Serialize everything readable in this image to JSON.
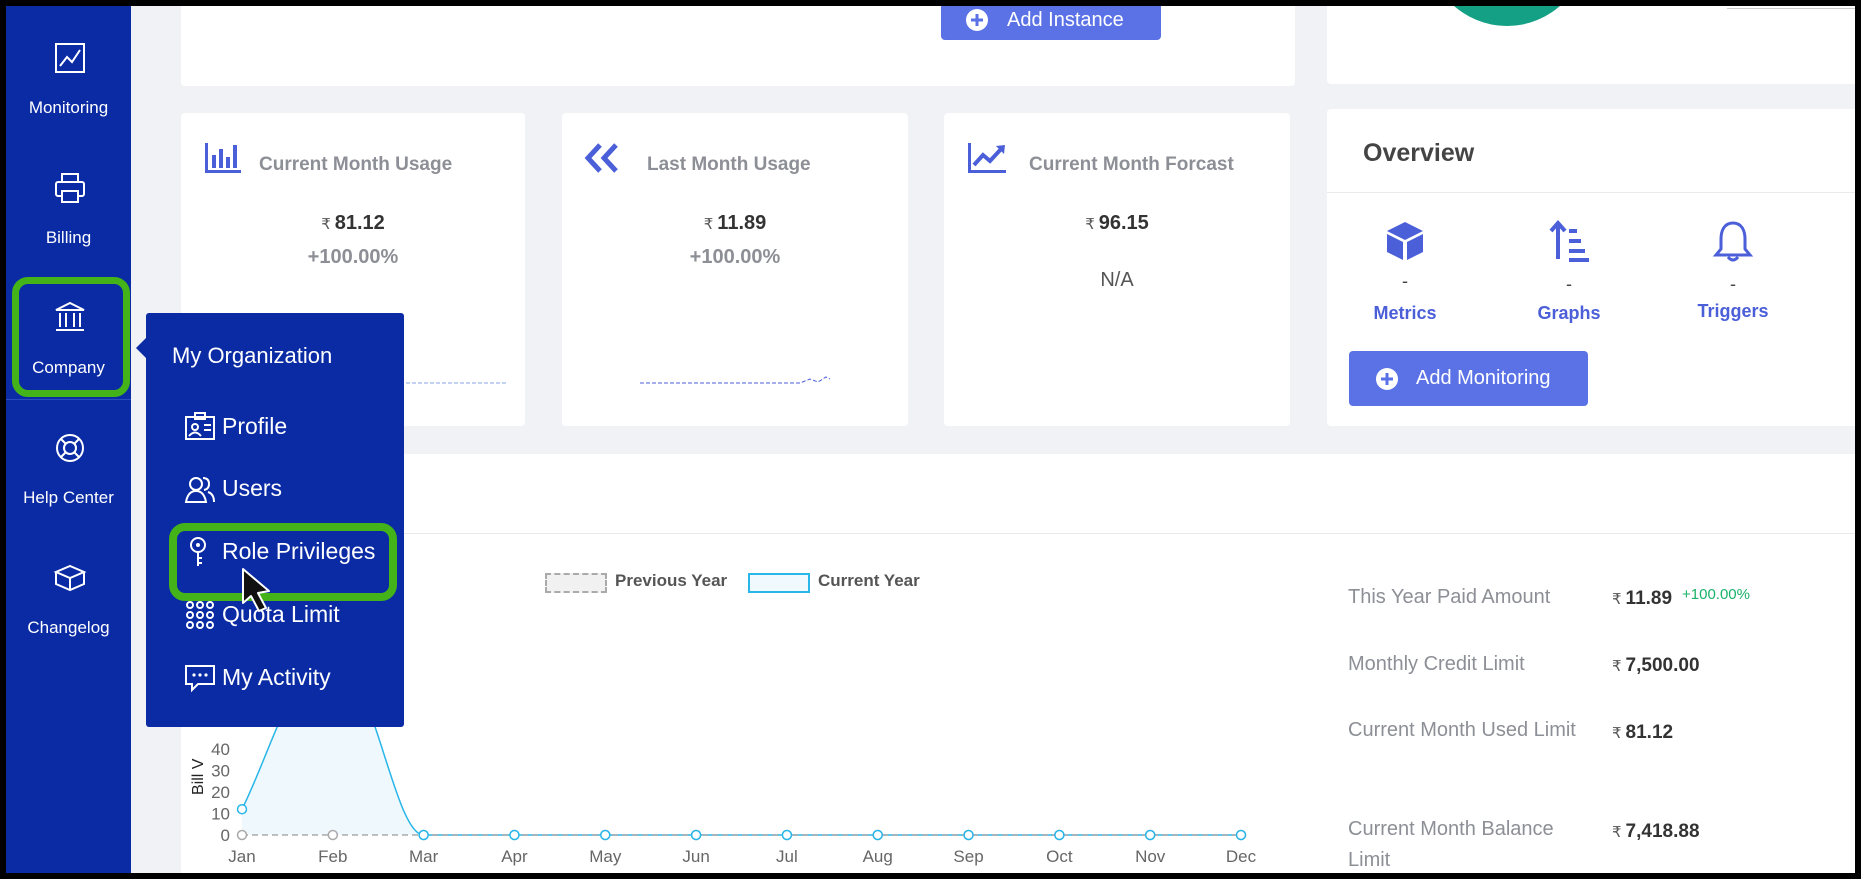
{
  "sidebar": {
    "items": [
      {
        "label": "Monitoring",
        "icon": "chart-line-icon"
      },
      {
        "label": "Billing",
        "icon": "printer-icon"
      },
      {
        "label": "Company",
        "icon": "bank-icon"
      },
      {
        "label": "Help Center",
        "icon": "lifebuoy-icon"
      },
      {
        "label": "Changelog",
        "icon": "box-icon"
      }
    ],
    "active": "Company"
  },
  "top": {
    "add_instance_label": "Add Instance"
  },
  "usage_cards": [
    {
      "title": "Current Month Usage",
      "currency": "₹",
      "value": "81.12",
      "change": "+100.00%"
    },
    {
      "title": "Last Month Usage",
      "currency": "₹",
      "value": "11.89",
      "change": "+100.00%"
    },
    {
      "title": "Current Month Forcast",
      "currency": "₹",
      "value": "96.15",
      "note": "N/A"
    }
  ],
  "overview": {
    "title": "Overview",
    "stats": [
      {
        "label": "Metrics",
        "value": "-",
        "icon": "cube-icon"
      },
      {
        "label": "Graphs",
        "value": "-",
        "icon": "sort-list-icon"
      },
      {
        "label": "Triggers",
        "value": "-",
        "icon": "bell-icon"
      }
    ],
    "add_monitoring_label": "Add Monitoring"
  },
  "org_menu": {
    "title": "My Organization",
    "items": [
      {
        "label": "Profile",
        "icon": "id-card-icon"
      },
      {
        "label": "Users",
        "icon": "users-icon"
      },
      {
        "label": "Role Privileges",
        "icon": "key-icon"
      },
      {
        "label": "Quota Limit",
        "icon": "grid-dots-icon"
      },
      {
        "label": "My Activity",
        "icon": "chat-icon"
      }
    ],
    "highlighted": "Role Privileges"
  },
  "chart_data": {
    "type": "line",
    "categories": [
      "Jan",
      "Feb",
      "Mar",
      "Apr",
      "May",
      "Jun",
      "Jul",
      "Aug",
      "Sep",
      "Oct",
      "Nov",
      "Dec"
    ],
    "series": [
      {
        "name": "Previous Year",
        "values": [
          0,
          0,
          0,
          0,
          0,
          0,
          0,
          0,
          0,
          0,
          0,
          0
        ],
        "style": "dashed",
        "color": "#aaaaaa"
      },
      {
        "name": "Current Year",
        "values": [
          12,
          81,
          0,
          0,
          0,
          0,
          0,
          0,
          0,
          0,
          0,
          0
        ],
        "style": "solid",
        "color": "#29b6e8"
      }
    ],
    "ylabel": "Bill V",
    "yticks": [
      0,
      10,
      20,
      30,
      40
    ],
    "ylim": [
      0,
      90
    ],
    "legend_position": "top-center"
  },
  "summary": {
    "items": [
      {
        "label": "This Year Paid Amount",
        "currency": "₹",
        "value": "11.89",
        "badge": "+100.00%"
      },
      {
        "label": "Monthly Credit Limit",
        "currency": "₹",
        "value": "7,500.00"
      },
      {
        "label": "Current Month Used Limit",
        "currency": "₹",
        "value": "81.12"
      },
      {
        "label": "Current Month Balance Limit",
        "currency": "₹",
        "value": "7,418.88"
      }
    ]
  },
  "colors": {
    "sidebar": "#0a2ba4",
    "accent": "#5a72e6",
    "highlight": "#44b219",
    "positive": "#19b26a",
    "current_series": "#29b6e8"
  }
}
